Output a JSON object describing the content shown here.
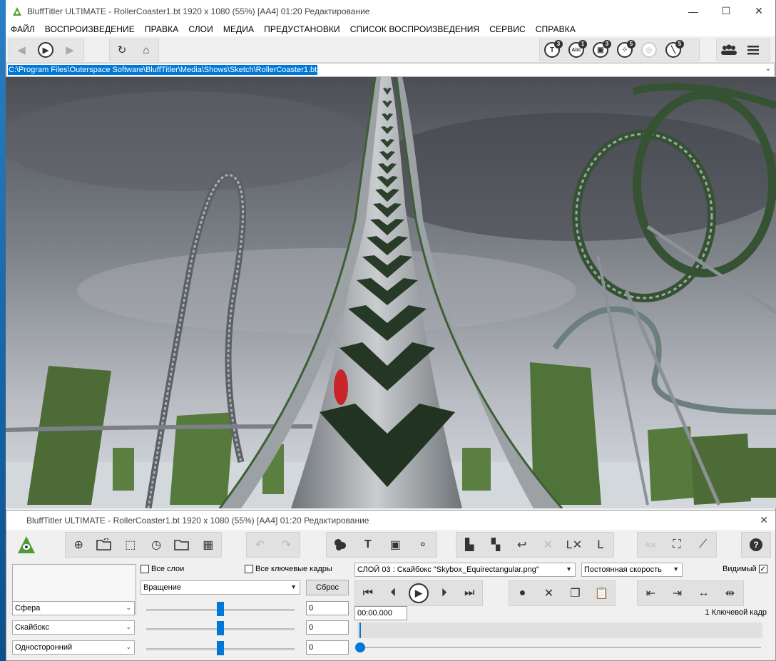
{
  "main_window": {
    "title": "BluffTitler ULTIMATE  - RollerCoaster1.bt 1920 x 1080 (55%) [AA4] 01:20 Редактирование",
    "controls": {
      "minimize": "—",
      "maximize": "☐",
      "close": "✕"
    }
  },
  "menu": [
    "ФАЙЛ",
    "ВОСПРОИЗВЕДЕНИЕ",
    "ПРАВКА",
    "СЛОИ",
    "МЕДИА",
    "ПРЕДУСТАНОВКИ",
    "СПИСОК ВОСПРОИЗВЕДЕНИЯ",
    "СЕРВИС",
    "СПРАВКА"
  ],
  "toolbar": {
    "nav": {
      "back": "back-icon",
      "play": "play-icon",
      "forward": "forward-icon"
    },
    "refresh": "refresh-icon",
    "home": "home-icon",
    "counters": [
      {
        "icon": "text-layer-icon",
        "glyph": "T",
        "count": "3"
      },
      {
        "icon": "abc-layer-icon",
        "glyph": "Abc",
        "count": "1"
      },
      {
        "icon": "picture-layer-icon",
        "glyph": "▣",
        "count": "3"
      },
      {
        "icon": "particle-layer-icon",
        "glyph": "⁘",
        "count": "5"
      },
      {
        "icon": "disabled-layer-icon",
        "glyph": "◎",
        "count": ""
      },
      {
        "icon": "camera-layer-icon",
        "glyph": "╲",
        "count": "5"
      }
    ],
    "right": [
      "users-icon",
      "hamburger-menu-icon"
    ]
  },
  "path": "C:\\Program Files\\Outerspace Software\\BluffTitler\\Media\\Shows\\Sketch\\RollerCoaster1.bt",
  "control_window": {
    "title": "BluffTitler ULTIMATE  - RollerCoaster1.bt 1920 x 1080 (55%) [AA4] 01:20 Редактирование",
    "close": "✕",
    "all_layers_label": "Все слои",
    "all_keyframes_label": "Все ключевые кадры",
    "property_select": "Вращение",
    "reset_button": "Сброс",
    "layer_select": "СЛОЙ 03      : Скайбокс \"Skybox_Equirectangular.png\"",
    "speed_select": "Постоянная скорость",
    "visible_label": "Видимый",
    "visible_checked": "✓",
    "time_value": "00:00.000",
    "keyframe_count": "1 Ключевой кадр",
    "param_rows": [
      {
        "select": "Сфера",
        "value": "0",
        "slider": 0.5
      },
      {
        "select": "Скайбокс",
        "value": "0",
        "slider": 0.5
      },
      {
        "select": "Односторонний",
        "value": "0",
        "slider": 0.5
      }
    ],
    "scrub_position": 0.0
  }
}
